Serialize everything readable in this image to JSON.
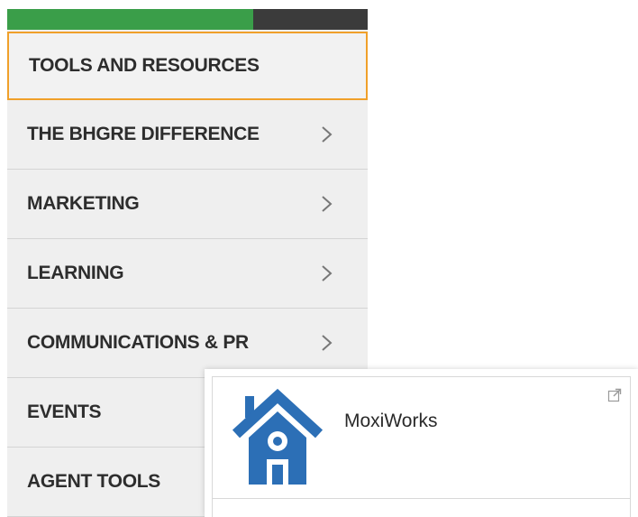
{
  "menu": {
    "items": [
      {
        "label": "TOOLS AND RESOURCES",
        "active": true,
        "chevron": false
      },
      {
        "label": "THE BHGRE DIFFERENCE",
        "active": false,
        "chevron": true
      },
      {
        "label": "MARKETING",
        "active": false,
        "chevron": true
      },
      {
        "label": "LEARNING",
        "active": false,
        "chevron": true
      },
      {
        "label": "COMMUNICATIONS & PR",
        "active": false,
        "chevron": true
      },
      {
        "label": "EVENTS",
        "active": false,
        "chevron": false
      },
      {
        "label": "AGENT TOOLS",
        "active": false,
        "chevron": false
      }
    ]
  },
  "colors": {
    "header_green": "#3a9e49",
    "header_dark": "#3b3b3b",
    "active_border": "#f0a02a",
    "logo_blue": "#2c6fb6"
  },
  "card": {
    "app_name": "MoxiWorks",
    "logo_icon": "house-icon",
    "link_icon": "external-link-icon"
  }
}
